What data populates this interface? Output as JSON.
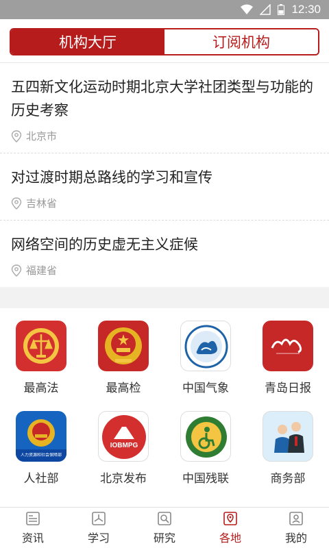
{
  "status_bar": {
    "time": "12:30",
    "icons": [
      "wifi-icon",
      "signal-icon",
      "battery-icon"
    ]
  },
  "segment": {
    "tabs": [
      {
        "label": "机构大厅",
        "active": true
      },
      {
        "label": "订阅机构",
        "active": false
      }
    ]
  },
  "articles": [
    {
      "title": "五四新文化运动时期北京大学社团类型与功能的历史考察",
      "location": "北京市"
    },
    {
      "title": "对过渡时期总路线的学习和宣传",
      "location": "吉林省"
    },
    {
      "title": "网络空间的历史虚无主义症候",
      "location": "福建省"
    }
  ],
  "institutions": [
    {
      "name": "最高法",
      "icon": "supreme-court-emblem"
    },
    {
      "name": "最高检",
      "icon": "procuratorate-emblem"
    },
    {
      "name": "中国气象",
      "icon": "meteorology-emblem"
    },
    {
      "name": "青岛日报",
      "icon": "qingdao-daily-logo"
    },
    {
      "name": "人社部",
      "icon": "hrss-emblem",
      "caption": "人力资源和社会保障部"
    },
    {
      "name": "北京发布",
      "icon": "beijing-release-logo",
      "caption": "IOBMPG"
    },
    {
      "name": "中国残联",
      "icon": "disabled-federation-logo"
    },
    {
      "name": "商务部",
      "icon": "commerce-ministry-logo"
    }
  ],
  "bottom_nav": [
    {
      "label": "资讯",
      "icon": "news-icon",
      "active": false
    },
    {
      "label": "学习",
      "icon": "study-icon",
      "active": false
    },
    {
      "label": "研究",
      "icon": "research-icon",
      "active": false
    },
    {
      "label": "各地",
      "icon": "location-icon",
      "active": true
    },
    {
      "label": "我的",
      "icon": "profile-icon",
      "active": false
    }
  ],
  "colors": {
    "brand_red": "#b71c1c",
    "status_bar": "#9e9e9e",
    "text": "#222222",
    "meta": "#999999"
  }
}
